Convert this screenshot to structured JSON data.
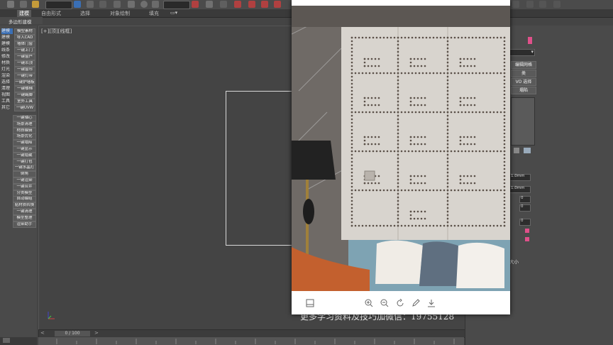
{
  "ribbon": {
    "tabs": [
      "建模",
      "自由形式",
      "选择",
      "对象绘制",
      "填充"
    ]
  },
  "subribbon": {
    "label": "多边形建模"
  },
  "left_panel": {
    "rows": [
      {
        "cat": "建模",
        "btn": "模型素材"
      },
      {
        "cat": "建模",
        "btn": "导入CAD"
      },
      {
        "cat": "建模",
        "btn": "墙体门窗"
      },
      {
        "cat": "线条",
        "btn": "一键上门"
      },
      {
        "cat": "修改",
        "btn": "一键窗户"
      },
      {
        "cat": "材质",
        "btn": "一键吊顶"
      },
      {
        "cat": "灯光",
        "btn": "一键窗帘"
      },
      {
        "cat": "渲染",
        "btn": "一键灯带"
      },
      {
        "cat": "选择",
        "btn": "一键护墙板"
      },
      {
        "cat": "清理",
        "btn": "一键楼梯"
      },
      {
        "cat": "视图",
        "btn": "一键踢脚"
      },
      {
        "cat": "工具",
        "btn": "室外工具"
      },
      {
        "cat": "其它",
        "btn": "一键UVW"
      }
    ],
    "buttons": [
      "一键轴心",
      "场景清理",
      "材质编辑",
      "场景优化",
      "一键塌陷",
      "一键显示",
      "一键隐藏",
      "一键打包",
      "一键水晶灯",
      "倒角",
      "一键渲染",
      "一键合并",
      "分类模型",
      "自动编组",
      "贴材质转换",
      "一键清理",
      "模型整理",
      "渲染助手"
    ]
  },
  "viewport": {
    "label": "[+][顶][线框]"
  },
  "caption": {
    "text": "更多学习资料及技巧加微信：19755128"
  },
  "timeline": {
    "slider": "0 / 100"
  },
  "right_panel": {
    "buttons": [
      "编辑网格",
      "类",
      "VO 选择",
      "塌陷"
    ],
    "field_values": [
      "1.0mm",
      "1.0mm",
      "0",
      "0",
      "0"
    ],
    "small_label": "大小"
  },
  "image_viewer": {
    "tools": [
      "gallery-icon",
      "zoom-in-icon",
      "zoom-out-icon",
      "rotate-icon",
      "edit-icon",
      "download-icon"
    ]
  },
  "colors": {
    "accent": "#e0508a",
    "selected": "#3a6fb5"
  }
}
